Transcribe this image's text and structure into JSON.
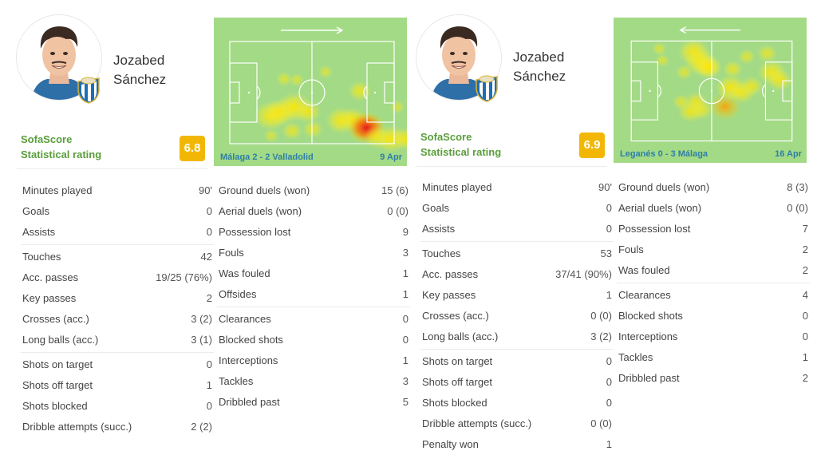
{
  "players": [
    {
      "first_name": "Jozabed",
      "last_name": "Sánchez",
      "rating_label_line1": "SofaScore",
      "rating_label_line2": "Statistical rating",
      "rating": "6.8",
      "rating_color": "#f2b705",
      "heatmap": {
        "attack_direction": "right",
        "match": "Málaga 2 - 2 Valladolid",
        "date": "9 Apr"
      },
      "stats_left": [
        [
          {
            "label": "Minutes played",
            "value": "90'"
          },
          {
            "label": "Goals",
            "value": "0"
          },
          {
            "label": "Assists",
            "value": "0"
          }
        ],
        [
          {
            "label": "Touches",
            "value": "42"
          },
          {
            "label": "Acc. passes",
            "value": "19/25 (76%)"
          },
          {
            "label": "Key passes",
            "value": "2"
          },
          {
            "label": "Crosses (acc.)",
            "value": "3 (2)"
          },
          {
            "label": "Long balls (acc.)",
            "value": "3 (1)"
          }
        ],
        [
          {
            "label": "Shots on target",
            "value": "0"
          },
          {
            "label": "Shots off target",
            "value": "1"
          },
          {
            "label": "Shots blocked",
            "value": "0"
          },
          {
            "label": "Dribble attempts (succ.)",
            "value": "2 (2)"
          }
        ]
      ],
      "stats_right": [
        [
          {
            "label": "Ground duels (won)",
            "value": "15 (6)"
          },
          {
            "label": "Aerial duels (won)",
            "value": "0 (0)"
          },
          {
            "label": "Possession lost",
            "value": "9"
          },
          {
            "label": "Fouls",
            "value": "3"
          },
          {
            "label": "Was fouled",
            "value": "1"
          },
          {
            "label": "Offsides",
            "value": "1"
          }
        ],
        [
          {
            "label": "Clearances",
            "value": "0"
          },
          {
            "label": "Blocked shots",
            "value": "0"
          },
          {
            "label": "Interceptions",
            "value": "1"
          },
          {
            "label": "Tackles",
            "value": "3"
          },
          {
            "label": "Dribbled past",
            "value": "5"
          }
        ]
      ]
    },
    {
      "first_name": "Jozabed",
      "last_name": "Sánchez",
      "rating_label_line1": "SofaScore",
      "rating_label_line2": "Statistical rating",
      "rating": "6.9",
      "rating_color": "#f2b705",
      "heatmap": {
        "attack_direction": "left",
        "match": "Leganés 0 - 3 Málaga",
        "date": "16 Apr"
      },
      "stats_left": [
        [
          {
            "label": "Minutes played",
            "value": "90'"
          },
          {
            "label": "Goals",
            "value": "0"
          },
          {
            "label": "Assists",
            "value": "0"
          }
        ],
        [
          {
            "label": "Touches",
            "value": "53"
          },
          {
            "label": "Acc. passes",
            "value": "37/41 (90%)"
          },
          {
            "label": "Key passes",
            "value": "1"
          },
          {
            "label": "Crosses (acc.)",
            "value": "0 (0)"
          },
          {
            "label": "Long balls (acc.)",
            "value": "3 (2)"
          }
        ],
        [
          {
            "label": "Shots on target",
            "value": "0"
          },
          {
            "label": "Shots off target",
            "value": "0"
          },
          {
            "label": "Shots blocked",
            "value": "0"
          },
          {
            "label": "Dribble attempts (succ.)",
            "value": "0 (0)"
          },
          {
            "label": "Penalty won",
            "value": "1"
          }
        ]
      ],
      "stats_right": [
        [
          {
            "label": "Ground duels (won)",
            "value": "8 (3)"
          },
          {
            "label": "Aerial duels (won)",
            "value": "0 (0)"
          },
          {
            "label": "Possession lost",
            "value": "7"
          },
          {
            "label": "Fouls",
            "value": "2"
          },
          {
            "label": "Was fouled",
            "value": "2"
          }
        ],
        [
          {
            "label": "Clearances",
            "value": "4"
          },
          {
            "label": "Blocked shots",
            "value": "0"
          },
          {
            "label": "Interceptions",
            "value": "0"
          },
          {
            "label": "Tackles",
            "value": "1"
          },
          {
            "label": "Dribbled past",
            "value": "2"
          }
        ]
      ]
    }
  ],
  "colors": {
    "rating_green_text": "#5a9e3b",
    "pitch": "#a3da86",
    "match_text": "#2e7fa6"
  }
}
